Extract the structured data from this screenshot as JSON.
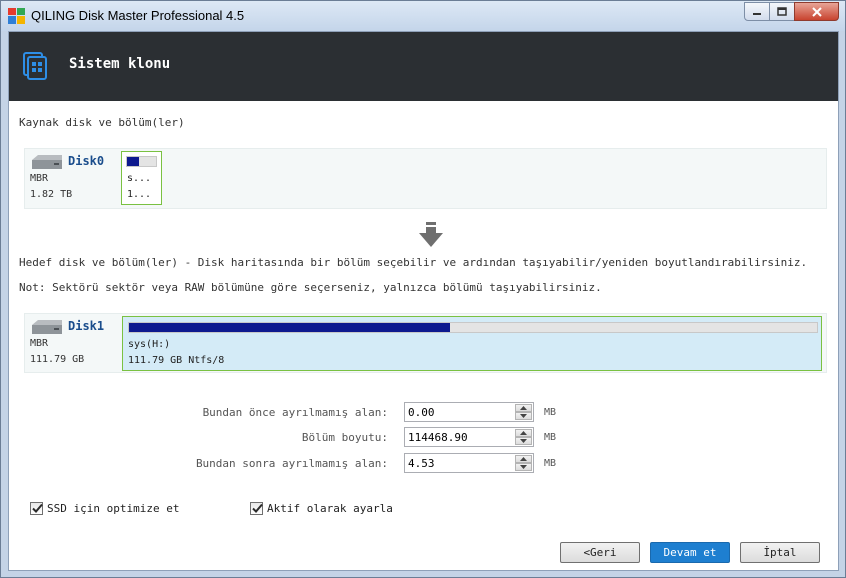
{
  "window": {
    "title": "QILING Disk Master Professional 4.5"
  },
  "header": {
    "title": "Sistem klonu"
  },
  "source": {
    "label": "Kaynak disk ve bölüm(ler)",
    "disk": {
      "name": "Disk0",
      "type": "MBR",
      "size": "1.82 TB"
    },
    "partition": {
      "name": "s...",
      "detail": "1...",
      "used_fraction": 0.4
    }
  },
  "target": {
    "label": "Hedef disk ve bölüm(ler) - Disk haritasında bir bölüm seçebilir ve ardından taşıyabilir/yeniden boyutlandırabilirsiniz.",
    "note": "Not: Sektörü sektör veya RAW bölümüne göre seçerseniz, yalnızca bölümü taşıyabilirsiniz.",
    "disk": {
      "name": "Disk1",
      "type": "MBR",
      "size": "111.79 GB"
    },
    "partition": {
      "name": "sys(H:)",
      "detail": "111.79 GB Ntfs/8",
      "used_fraction": 0.467
    }
  },
  "form": {
    "before_label": "Bundan önce ayrılmamış alan:",
    "before_value": "0.00",
    "size_label": "Bölüm boyutu:",
    "size_value": "114468.90",
    "after_label": "Bundan sonra ayrılmamış alan:",
    "after_value": "4.53",
    "unit": "MB"
  },
  "options": {
    "ssd_label": "SSD için optimize et",
    "ssd_checked": true,
    "active_label": "Aktif olarak ayarla",
    "active_checked": true
  },
  "buttons": {
    "back": "<Geri",
    "next": "Devam et",
    "cancel": "İptal"
  }
}
